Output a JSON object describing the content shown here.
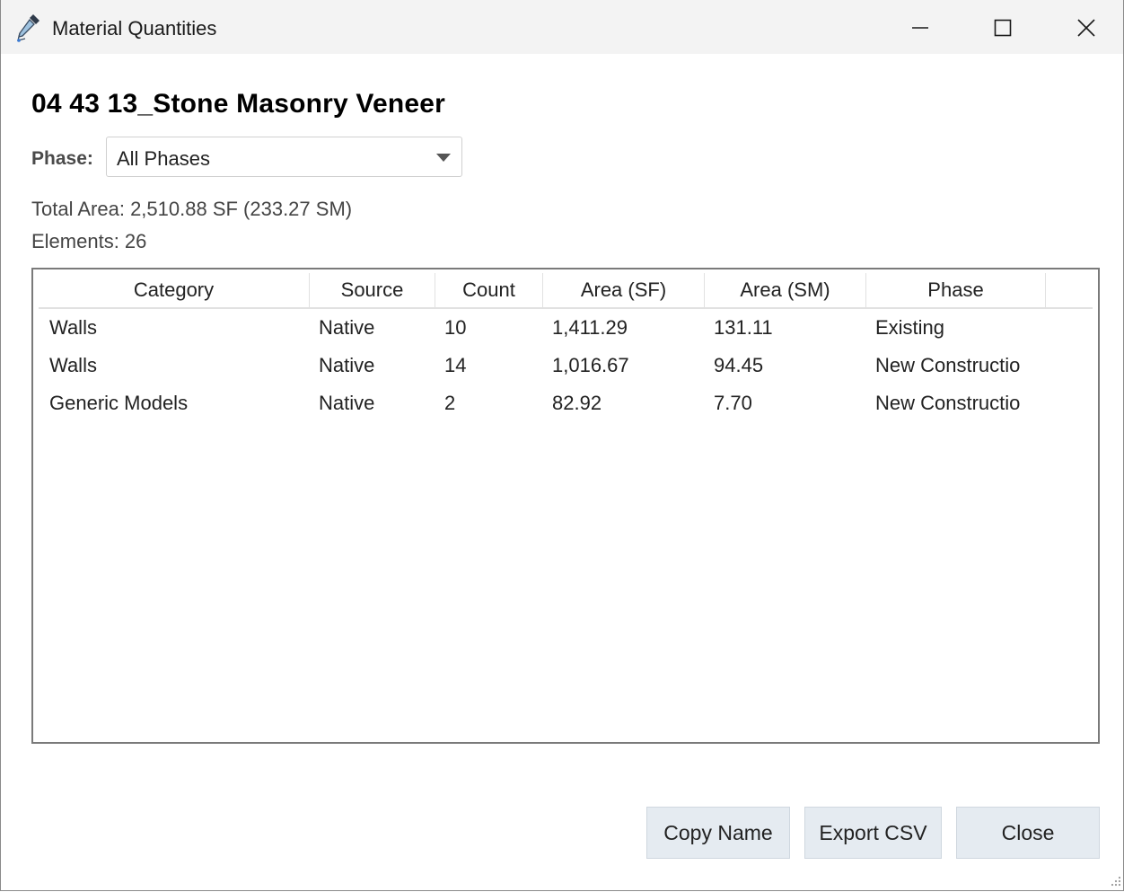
{
  "window": {
    "title": "Material Quantities",
    "icon": "eyedropper-icon",
    "controls": [
      "minimize-icon",
      "maximize-icon",
      "close-icon"
    ]
  },
  "heading": "04 43 13_Stone Masonry Veneer",
  "phase": {
    "label": "Phase:",
    "selected": "All Phases"
  },
  "summary": {
    "total_area": "Total Area: 2,510.88 SF  (233.27 SM)",
    "elements": "Elements: 26"
  },
  "table": {
    "columns": [
      "Category",
      "Source",
      "Count",
      "Area (SF)",
      "Area (SM)",
      "Phase"
    ],
    "rows": [
      [
        "Walls",
        "Native",
        "10",
        "1,411.29",
        "131.11",
        "Existing"
      ],
      [
        "Walls",
        "Native",
        "14",
        "1,016.67",
        "94.45",
        "New Constructio"
      ],
      [
        "Generic Models",
        "Native",
        "2",
        "82.92",
        "7.70",
        "New Constructio"
      ]
    ]
  },
  "buttons": {
    "copy_name": "Copy Name",
    "export_csv": "Export CSV",
    "close": "Close"
  },
  "colors": {
    "titlebar": "#f3f3f3",
    "button_bg": "#e5ebf1",
    "table_border": "#7a7a7a"
  }
}
